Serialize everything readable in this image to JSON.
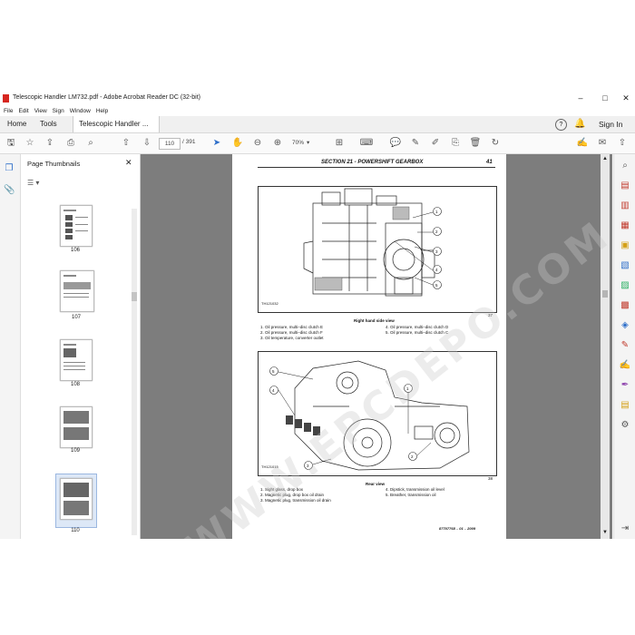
{
  "window": {
    "title": "Telescopic Handler LM732.pdf - Adobe Acrobat Reader DC (32-bit)",
    "controls": [
      "–",
      "□",
      "✕"
    ]
  },
  "menu": [
    "File",
    "Edit",
    "View",
    "Sign",
    "Window",
    "Help"
  ],
  "tabs": {
    "home": "Home",
    "tools": "Tools",
    "document": "Telescopic Handler ..."
  },
  "tabbar_right": {
    "sign_in": "Sign In"
  },
  "toolbar": {
    "page_current": "110",
    "page_total": "/ 391",
    "zoom": "70%"
  },
  "thumbnails": {
    "title": "Page Thumbnails",
    "pages": [
      "106",
      "107",
      "108",
      "109",
      "110"
    ],
    "selected": "110"
  },
  "page": {
    "section_header": "SECTION 21 - POWERSHIFT GEARBOX",
    "page_number": "41",
    "figure1": {
      "code": "TH121032",
      "number": "37",
      "caption": "Right hand side view",
      "callouts": [
        "1",
        "2",
        "3",
        "4",
        "5"
      ],
      "legend_left": [
        "1. Oil pressure, multi–disc clutch E",
        "2. Oil pressure, multi–disc clutch F",
        "3. Oil temperature, converter outlet"
      ],
      "legend_right": [
        "4. Oil pressure, multi–disc clutch D",
        "5. Oil pressure, multi–disc clutch C"
      ]
    },
    "figure2": {
      "code": "TH121015",
      "number": "38",
      "caption": "Rear view",
      "callouts": [
        "5",
        "4",
        "1",
        "2",
        "3"
      ],
      "legend_left": [
        "1. Sight glass, drop box",
        "2. Magnetic plug, drop box oil drain",
        "3. Magnetic plug, transmission oil drain"
      ],
      "legend_right": [
        "4. Dipstick, transmission oil level",
        "5. Breather, transmission oil"
      ]
    },
    "footer": "87707768 – 01 – 2009"
  },
  "watermark": "WWW.EPCDEPO.COM",
  "colors": {
    "accent": "#2d6ec9",
    "pdf_red": "#d6261f",
    "doc_bg": "#7d7d7d"
  }
}
